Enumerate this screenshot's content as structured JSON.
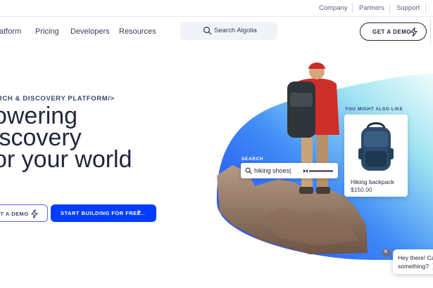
{
  "topbar": {
    "links": [
      "Company",
      "Partners",
      "Support"
    ]
  },
  "nav": {
    "links": [
      "atform",
      "Pricing",
      "Developers",
      "Resources"
    ],
    "search_label": "Search Algolia",
    "demo_button": "GET A DEMO"
  },
  "hero": {
    "eyebrow": "RCH & DISCOVERY PLATFORM/>",
    "headline": [
      "owering",
      "iscovery",
      "or your world"
    ],
    "demo_button": "ET A DEMO",
    "build_button": "START BUILDING FOR FREE",
    "build_arrow": ">_"
  },
  "illustration": {
    "search_label": "SEARCH",
    "search_query": "hiking shoes|",
    "recommend_label": "YOU MIGHT ALSO LIKE",
    "product_name": "Hiking backpack",
    "product_price": "$150.00"
  },
  "chat": {
    "line1": "Hey there! Ca",
    "line2": "something? 🚶"
  },
  "colors": {
    "accent": "#003dff",
    "text": "#23263b",
    "muted": "#5a5e7a"
  }
}
